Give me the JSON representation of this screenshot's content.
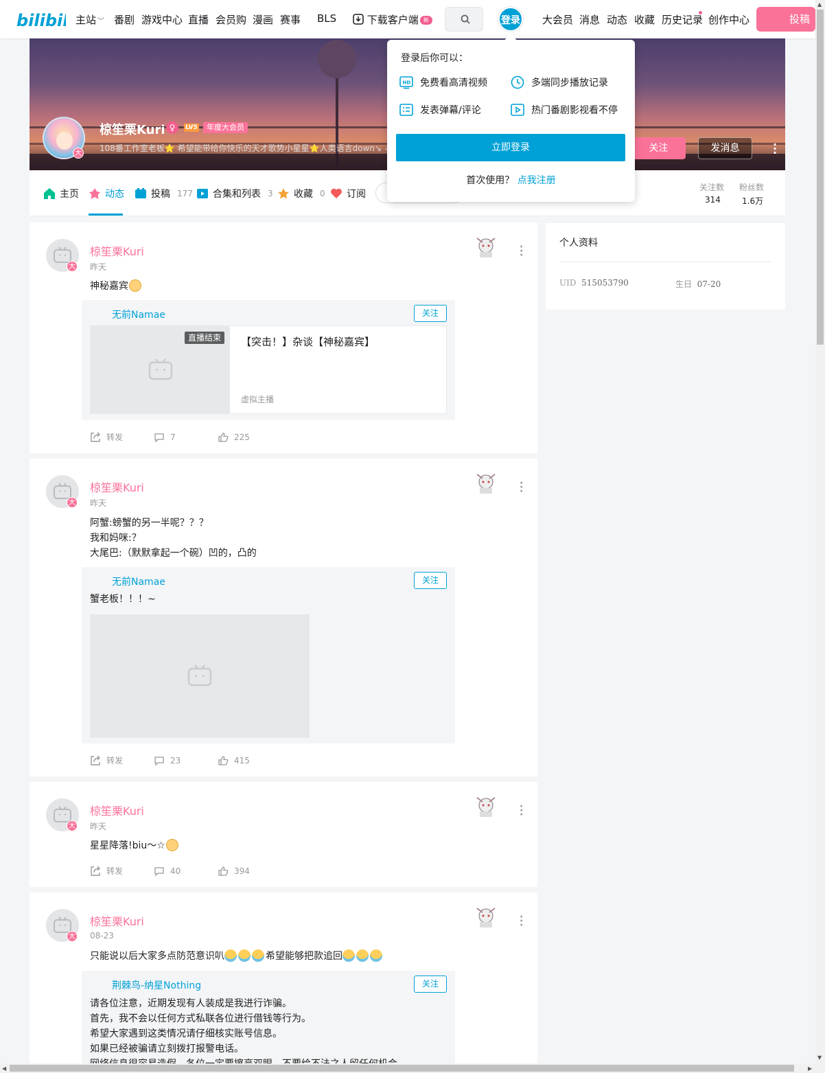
{
  "header": {
    "nav": [
      "主站",
      "番剧",
      "游戏中心",
      "直播",
      "会员购",
      "漫画",
      "赛事",
      "BLS"
    ],
    "download": "下载客户端",
    "new_badge": "新",
    "login": "登录",
    "right_nav": [
      "大会员",
      "消息",
      "动态",
      "收藏",
      "历史记录",
      "创作中心"
    ],
    "upload": "投稿"
  },
  "profile": {
    "name": "椋笙栗Kuri",
    "gender_symbol": "♀",
    "level": "LV5",
    "vip": "年度大会员",
    "sign": "108番工作室老板⭐ 希望能带给你快乐的天才歌势小星星⭐人类语言down↘ ✓",
    "avatar_badge": "大",
    "follow": "关注",
    "message": "发消息"
  },
  "tabs": [
    {
      "label": "主页",
      "count": ""
    },
    {
      "label": "动态",
      "count": ""
    },
    {
      "label": "投稿",
      "count": "177"
    },
    {
      "label": "合集和列表",
      "count": "3"
    },
    {
      "label": "收藏",
      "count": "0"
    },
    {
      "label": "订阅",
      "count": ""
    }
  ],
  "stats": {
    "following_label": "关注数",
    "following": "314",
    "fans_label": "粉丝数",
    "fans": "1.6万"
  },
  "login_popup": {
    "title": "登录后你可以：",
    "features": [
      "免费看高清视频",
      "多端同步播放记录",
      "发表弹幕/评论",
      "热门番剧影视看不停"
    ],
    "button": "立即登录",
    "first_use": "首次使用？",
    "register": "点我注册"
  },
  "side": {
    "title": "个人资料",
    "uid_label": "UID",
    "uid": "515053790",
    "birthday_label": "生日",
    "birthday": "07-20"
  },
  "posts": [
    {
      "author": "椋笙栗Kuri",
      "time": "昨天",
      "text": "神秘嘉宾",
      "repost": {
        "author": "无前Namae",
        "follow": "关注",
        "live_end": "直播结束",
        "live_title": "【突击！】杂谈【神秘嘉宾】",
        "live_category": "虚拟主播"
      },
      "share": "转发",
      "comments": "7",
      "likes": "225"
    },
    {
      "author": "椋笙栗Kuri",
      "time": "昨天",
      "text": "阿蟹:螃蟹的另一半呢？？？\n我和妈咪:？\n大尾巴:（默默拿起一个碗）凹的，凸的",
      "repost": {
        "author": "无前Namae",
        "follow": "关注",
        "text": "蟹老板！！！~"
      },
      "share": "转发",
      "comments": "23",
      "likes": "415"
    },
    {
      "author": "椋笙栗Kuri",
      "time": "昨天",
      "text": "星星降落!biu～☆",
      "share": "转发",
      "comments": "40",
      "likes": "394"
    },
    {
      "author": "椋笙栗Kuri",
      "time": "08-23",
      "text": "只能说以后大家多点防范意识叭",
      "text_tail": "希望能够把款追回",
      "repost": {
        "author": "荆棘鸟-纳星Nothing",
        "follow": "关注",
        "text": "请各位注意，近期发现有人装成是我进行诈骗。\n首先，我不会以任何方式私联各位进行借钱等行为。\n希望大家遇到这类情况请仔细核实账号信息。\n如果已经被骗请立刻拨打报警电话。\n网络信息很容易造假，各位一定要擦亮双眼，不要给不法之人留任何机会。"
      }
    }
  ]
}
